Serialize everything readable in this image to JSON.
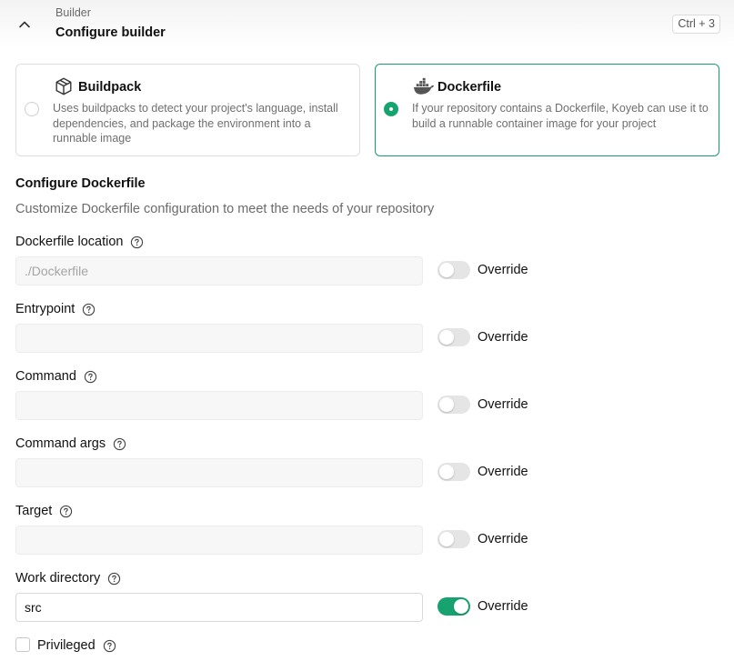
{
  "header": {
    "eyebrow": "Builder",
    "title": "Configure builder",
    "shortcut": "Ctrl + 3",
    "collapse_icon": "chevron-up-icon"
  },
  "builders": [
    {
      "title": "Buildpack",
      "description": "Uses buildpacks to detect your project's language, install dependencies, and package the environment into a runnable image",
      "icon": "package-box-icon",
      "selected": false
    },
    {
      "title": "Dockerfile",
      "description": "If your repository contains a Dockerfile, Koyeb can use it to build a runnable container image for your project",
      "icon": "docker-whale-icon",
      "selected": true
    }
  ],
  "section": {
    "title": "Configure Dockerfile",
    "subtitle": "Customize Dockerfile configuration to meet the needs of your repository"
  },
  "fields": [
    {
      "label": "Dockerfile location",
      "value": "",
      "placeholder": "./Dockerfile",
      "override_label": "Override",
      "override": false
    },
    {
      "label": "Entrypoint",
      "value": "",
      "placeholder": "",
      "override_label": "Override",
      "override": false
    },
    {
      "label": "Command",
      "value": "",
      "placeholder": "",
      "override_label": "Override",
      "override": false
    },
    {
      "label": "Command args",
      "value": "",
      "placeholder": "",
      "override_label": "Override",
      "override": false
    },
    {
      "label": "Target",
      "value": "",
      "placeholder": "",
      "override_label": "Override",
      "override": false
    },
    {
      "label": "Work directory",
      "value": "src",
      "placeholder": "",
      "override_label": "Override",
      "override": true
    }
  ],
  "privileged": {
    "label": "Privileged",
    "checked": false
  },
  "colors": {
    "accent": "#17a36f",
    "selected_border": "#1a9c70",
    "muted_text": "#6b6b6b"
  }
}
